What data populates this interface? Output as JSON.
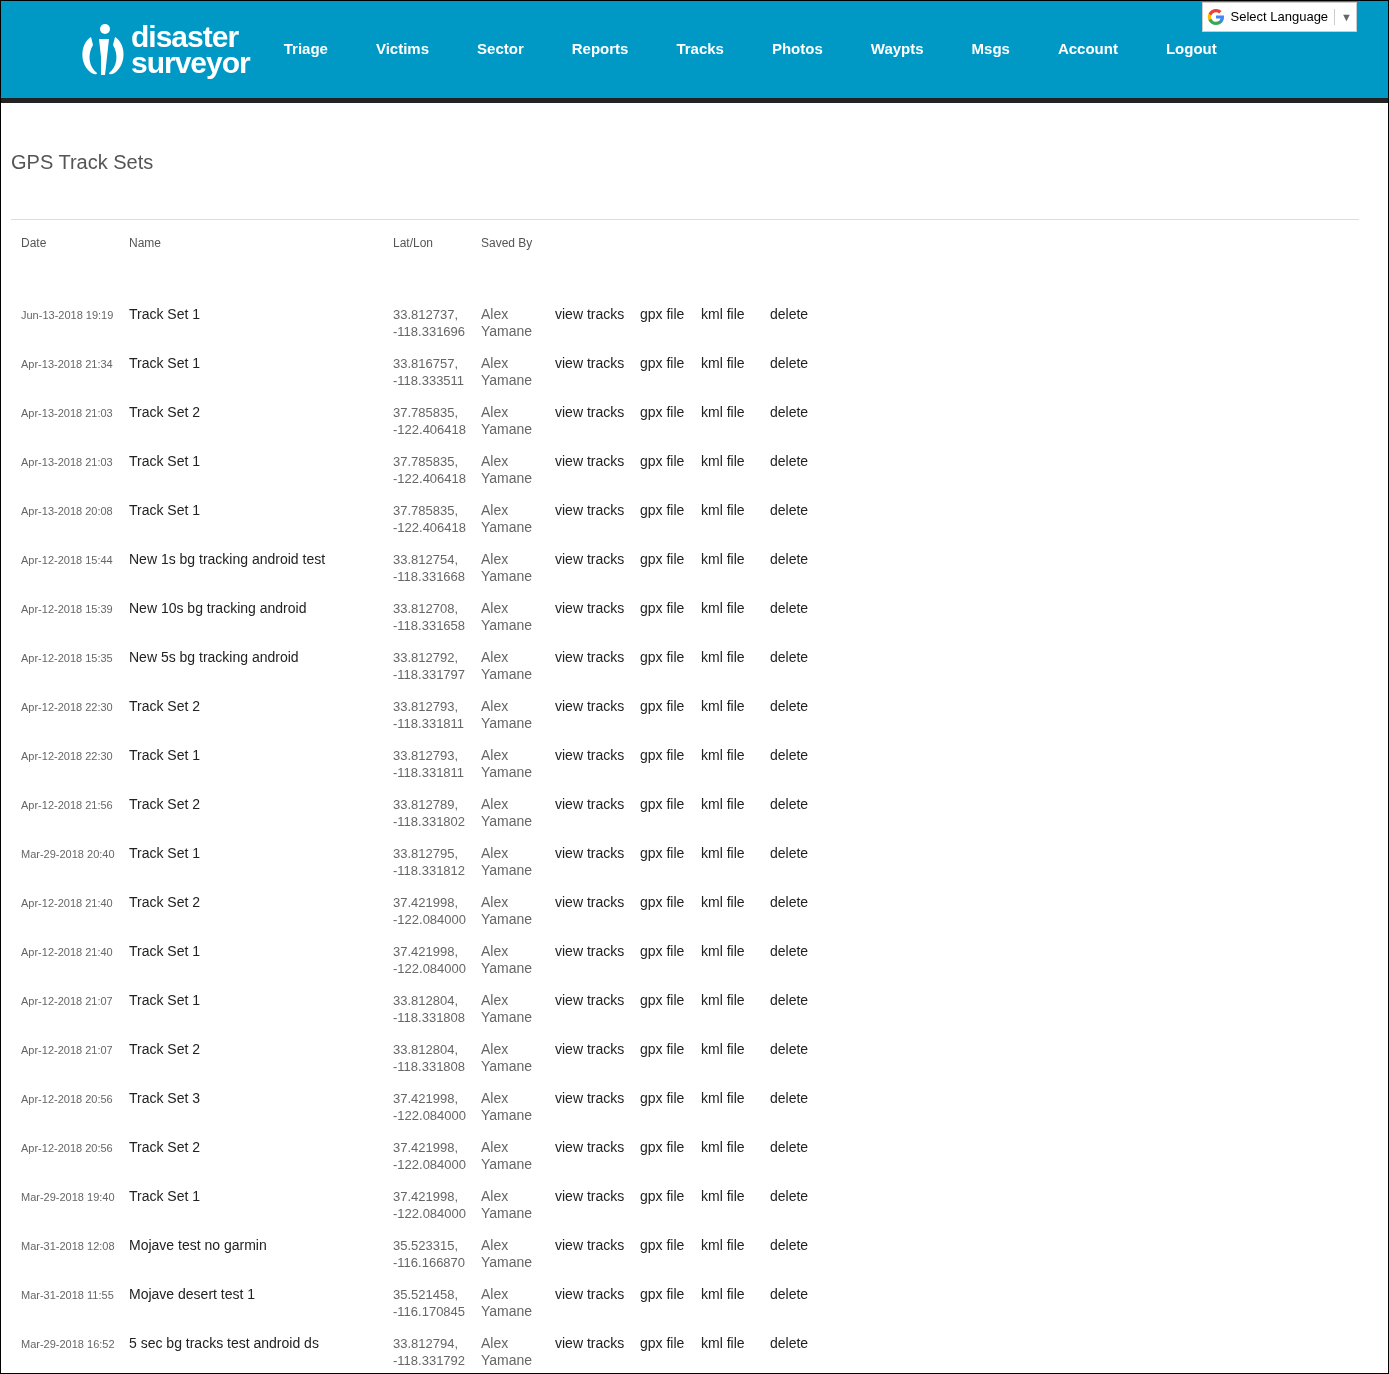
{
  "header": {
    "logo": {
      "line_1": "disaster",
      "line_2": "surveyor"
    },
    "nav": [
      "Triage",
      "Victims",
      "Sector",
      "Reports",
      "Tracks",
      "Photos",
      "Waypts",
      "Msgs",
      "Account",
      "Logout"
    ],
    "language_select": {
      "label": "Select Language",
      "caret": "▼"
    }
  },
  "page_title": "GPS Track Sets",
  "table": {
    "columns": [
      "Date",
      "Name",
      "Lat/Lon",
      "Saved By"
    ],
    "rows": [
      {
        "date": "Jun-13-2018 19:19",
        "name": "Track Set 1",
        "lat": "33.812737,",
        "lon": "-118.331696",
        "saved_by": "Alex Yamane",
        "actions": [
          "view tracks",
          "gpx file",
          "kml file",
          "delete"
        ]
      },
      {
        "date": "Apr-13-2018 21:34",
        "name": "Track Set 1",
        "lat": "33.816757,",
        "lon": "-118.333511",
        "saved_by": "Alex Yamane",
        "actions": [
          "view tracks",
          "gpx file",
          "kml file",
          "delete"
        ]
      },
      {
        "date": "Apr-13-2018 21:03",
        "name": "Track Set 2",
        "lat": "37.785835,",
        "lon": "-122.406418",
        "saved_by": "Alex Yamane",
        "actions": [
          "view tracks",
          "gpx file",
          "kml file",
          "delete"
        ]
      },
      {
        "date": "Apr-13-2018 21:03",
        "name": "Track Set 1",
        "lat": "37.785835,",
        "lon": "-122.406418",
        "saved_by": "Alex Yamane",
        "actions": [
          "view tracks",
          "gpx file",
          "kml file",
          "delete"
        ]
      },
      {
        "date": "Apr-13-2018 20:08",
        "name": "Track Set 1",
        "lat": "37.785835,",
        "lon": "-122.406418",
        "saved_by": "Alex Yamane",
        "actions": [
          "view tracks",
          "gpx file",
          "kml file",
          "delete"
        ]
      },
      {
        "date": "Apr-12-2018 15:44",
        "name": "New 1s bg tracking android test",
        "lat": "33.812754,",
        "lon": "-118.331668",
        "saved_by": "Alex Yamane",
        "actions": [
          "view tracks",
          "gpx file",
          "kml file",
          "delete"
        ]
      },
      {
        "date": "Apr-12-2018 15:39",
        "name": "New 10s bg tracking android",
        "lat": "33.812708,",
        "lon": "-118.331658",
        "saved_by": "Alex Yamane",
        "actions": [
          "view tracks",
          "gpx file",
          "kml file",
          "delete"
        ]
      },
      {
        "date": "Apr-12-2018 15:35",
        "name": "New 5s bg tracking android",
        "lat": "33.812792,",
        "lon": "-118.331797",
        "saved_by": "Alex Yamane",
        "actions": [
          "view tracks",
          "gpx file",
          "kml file",
          "delete"
        ]
      },
      {
        "date": "Apr-12-2018 22:30",
        "name": "Track Set 2",
        "lat": "33.812793,",
        "lon": "-118.331811",
        "saved_by": "Alex Yamane",
        "actions": [
          "view tracks",
          "gpx file",
          "kml file",
          "delete"
        ]
      },
      {
        "date": "Apr-12-2018 22:30",
        "name": "Track Set 1",
        "lat": "33.812793,",
        "lon": "-118.331811",
        "saved_by": "Alex Yamane",
        "actions": [
          "view tracks",
          "gpx file",
          "kml file",
          "delete"
        ]
      },
      {
        "date": "Apr-12-2018 21:56",
        "name": "Track Set 2",
        "lat": "33.812789,",
        "lon": "-118.331802",
        "saved_by": "Alex Yamane",
        "actions": [
          "view tracks",
          "gpx file",
          "kml file",
          "delete"
        ]
      },
      {
        "date": "Mar-29-2018 20:40",
        "name": "Track Set 1",
        "lat": "33.812795,",
        "lon": "-118.331812",
        "saved_by": "Alex Yamane",
        "actions": [
          "view tracks",
          "gpx file",
          "kml file",
          "delete"
        ]
      },
      {
        "date": "Apr-12-2018 21:40",
        "name": "Track Set 2",
        "lat": "37.421998,",
        "lon": "-122.084000",
        "saved_by": "Alex Yamane",
        "actions": [
          "view tracks",
          "gpx file",
          "kml file",
          "delete"
        ]
      },
      {
        "date": "Apr-12-2018 21:40",
        "name": "Track Set 1",
        "lat": "37.421998,",
        "lon": "-122.084000",
        "saved_by": "Alex Yamane",
        "actions": [
          "view tracks",
          "gpx file",
          "kml file",
          "delete"
        ]
      },
      {
        "date": "Apr-12-2018 21:07",
        "name": "Track Set 1",
        "lat": "33.812804,",
        "lon": "-118.331808",
        "saved_by": "Alex Yamane",
        "actions": [
          "view tracks",
          "gpx file",
          "kml file",
          "delete"
        ]
      },
      {
        "date": "Apr-12-2018 21:07",
        "name": "Track Set 2",
        "lat": "33.812804,",
        "lon": "-118.331808",
        "saved_by": "Alex Yamane",
        "actions": [
          "view tracks",
          "gpx file",
          "kml file",
          "delete"
        ]
      },
      {
        "date": "Apr-12-2018 20:56",
        "name": "Track Set 3",
        "lat": "37.421998,",
        "lon": "-122.084000",
        "saved_by": "Alex Yamane",
        "actions": [
          "view tracks",
          "gpx file",
          "kml file",
          "delete"
        ]
      },
      {
        "date": "Apr-12-2018 20:56",
        "name": "Track Set 2",
        "lat": "37.421998,",
        "lon": "-122.084000",
        "saved_by": "Alex Yamane",
        "actions": [
          "view tracks",
          "gpx file",
          "kml file",
          "delete"
        ]
      },
      {
        "date": "Mar-29-2018 19:40",
        "name": "Track Set 1",
        "lat": "37.421998,",
        "lon": "-122.084000",
        "saved_by": "Alex Yamane",
        "actions": [
          "view tracks",
          "gpx file",
          "kml file",
          "delete"
        ]
      },
      {
        "date": "Mar-31-2018 12:08",
        "name": "Mojave test no garmin",
        "lat": "35.523315,",
        "lon": "-116.166870",
        "saved_by": "Alex Yamane",
        "actions": [
          "view tracks",
          "gpx file",
          "kml file",
          "delete"
        ]
      },
      {
        "date": "Mar-31-2018 11:55",
        "name": "Mojave desert test 1",
        "lat": "35.521458,",
        "lon": "-116.170845",
        "saved_by": "Alex Yamane",
        "actions": [
          "view tracks",
          "gpx file",
          "kml file",
          "delete"
        ]
      },
      {
        "date": "Mar-29-2018 16:52",
        "name": "5 sec bg tracks test android ds",
        "lat": "33.812794,",
        "lon": "-118.331792",
        "saved_by": "Alex Yamane",
        "actions": [
          "view tracks",
          "gpx file",
          "kml file",
          "delete"
        ]
      }
    ]
  }
}
